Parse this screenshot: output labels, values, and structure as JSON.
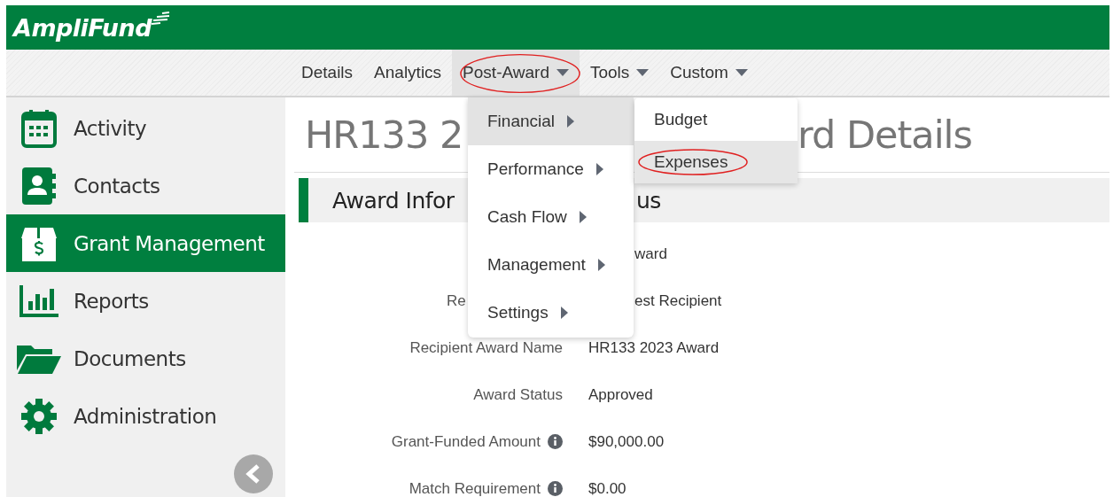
{
  "app": {
    "logo": "AmpliFund"
  },
  "nav": [
    {
      "label": "Details",
      "dropdown": false,
      "selected": false,
      "circled": false
    },
    {
      "label": "Analytics",
      "dropdown": false,
      "selected": false,
      "circled": false
    },
    {
      "label": "Post-Award",
      "dropdown": true,
      "selected": true,
      "circled": true
    },
    {
      "label": "Tools",
      "dropdown": true,
      "selected": false,
      "circled": false
    },
    {
      "label": "Custom",
      "dropdown": true,
      "selected": false,
      "circled": false
    }
  ],
  "sidebar": {
    "items": [
      {
        "label": "Activity",
        "kind": "calendar",
        "selected": false
      },
      {
        "label": "Contacts",
        "kind": "contact",
        "selected": false
      },
      {
        "label": "Grant Management",
        "kind": "grant",
        "selected": true
      },
      {
        "label": "Reports",
        "kind": "chart",
        "selected": false
      },
      {
        "label": "Documents",
        "kind": "folder",
        "selected": false
      },
      {
        "label": "Administration",
        "kind": "gear",
        "selected": false
      }
    ]
  },
  "page": {
    "title_left": "HR133 2",
    "title_right": "rd Details",
    "section_left": "Award Infor",
    "section_right": "us",
    "fields": [
      {
        "kind": "covered",
        "value": "ward"
      },
      {
        "kind": "covered",
        "label": "Re",
        "value": "est Recipient"
      },
      {
        "kind": "full",
        "label": "Recipient Award Name",
        "value": "HR133 2023 Award",
        "info": false
      },
      {
        "kind": "full",
        "label": "Award Status",
        "value": "Approved",
        "info": false
      },
      {
        "kind": "full",
        "label": "Grant-Funded Amount",
        "value": "$90,000.00",
        "info": true
      },
      {
        "kind": "full",
        "label": "Match Requirement",
        "value": "$0.00",
        "info": true
      }
    ]
  },
  "menu": {
    "items": [
      {
        "label": "Financial",
        "selected": true
      },
      {
        "label": "Performance",
        "selected": false
      },
      {
        "label": "Cash Flow",
        "selected": false
      },
      {
        "label": "Management",
        "selected": false
      },
      {
        "label": "Settings",
        "selected": false
      }
    ],
    "submenu": [
      {
        "label": "Budget",
        "selected": false,
        "circled": false
      },
      {
        "label": "Expenses",
        "selected": true,
        "circled": true
      }
    ]
  }
}
